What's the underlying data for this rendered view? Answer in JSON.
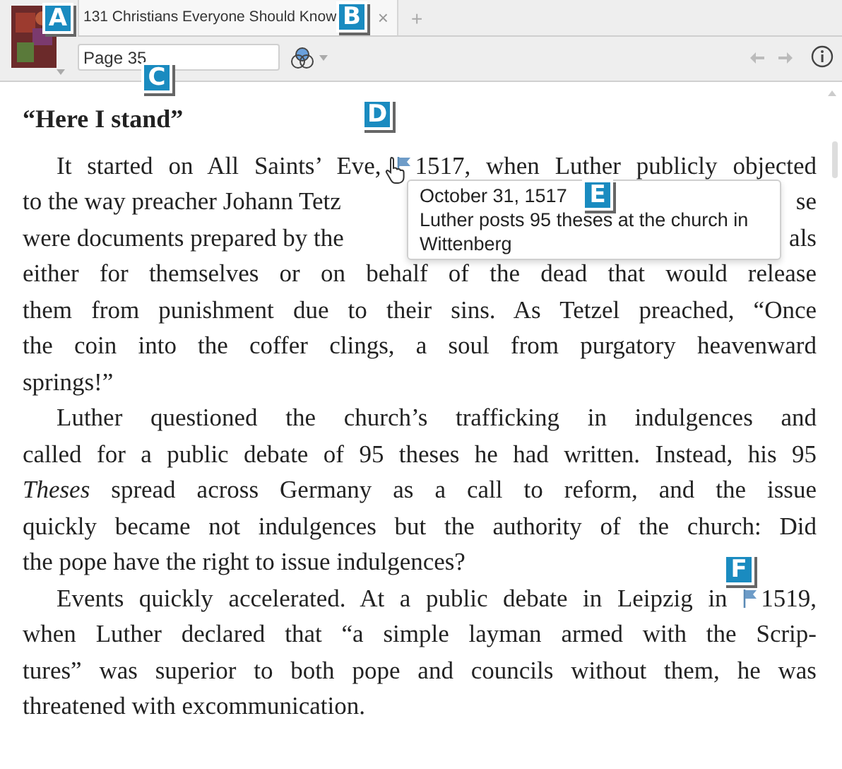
{
  "tab": {
    "title": "131 Christians Everyone Should Know",
    "close": "×",
    "new": "+"
  },
  "toolbar": {
    "page_field": {
      "value": "Page 35"
    }
  },
  "heading": "“Here I stand”",
  "paragraphs": [
    {
      "lines": [
        [
          {
            "kind": "text",
            "text": "It started on All Saints’ Eve,"
          },
          {
            "kind": "flag",
            "text": "1517, when Luther publicly objected"
          }
        ],
        [
          {
            "kind": "text",
            "text": "to the way preacher Johann Tetz"
          },
          {
            "kind": "gap"
          },
          {
            "kind": "text",
            "text": "se"
          }
        ],
        [
          {
            "kind": "text",
            "text": "were documents prepared by the"
          },
          {
            "kind": "gap"
          },
          {
            "kind": "text",
            "text": "als"
          }
        ],
        [
          {
            "kind": "text",
            "text": "either for themselves or on behalf of the dead that would release"
          }
        ],
        [
          {
            "kind": "text",
            "text": "them from punishment due to their sins. As Tetzel preached, “Once"
          }
        ],
        [
          {
            "kind": "text",
            "text": "the coin into the coffer clings, a soul from purgatory heavenward"
          }
        ],
        [
          {
            "kind": "text",
            "text": "springs!”"
          }
        ]
      ]
    },
    {
      "lines": [
        [
          {
            "kind": "text",
            "text": "Luther questioned the church’s trafficking in indulgences and"
          }
        ],
        [
          {
            "kind": "text",
            "text": "called for a public debate of 95 theses he had written. Instead, his 95"
          }
        ],
        [
          {
            "kind": "text",
            "text": "*Theses* spread across Germany as a call to reform, and the issue"
          }
        ],
        [
          {
            "kind": "text",
            "text": "quickly became not indulgences but the authority of the church: Did"
          }
        ],
        [
          {
            "kind": "text",
            "text": "the pope have the right to issue indulgences?"
          }
        ]
      ]
    },
    {
      "lines": [
        [
          {
            "kind": "text",
            "text": "Events quickly accelerated. At a public debate in Leipzig in"
          },
          {
            "kind": "flag",
            "text": "1519,"
          }
        ],
        [
          {
            "kind": "text",
            "text": "when Luther declared that “a simple layman armed with the Scrip-"
          }
        ],
        [
          {
            "kind": "text",
            "text": "tures” was superior to both pope and councils without them, he was"
          }
        ],
        [
          {
            "kind": "text",
            "text": "threatened with excommunication."
          }
        ]
      ]
    }
  ],
  "tooltip": {
    "date": "October 31, 1517",
    "text": "Luther posts 95 theses at the church in Wittenberg"
  },
  "callouts": [
    "A",
    "B",
    "C",
    "D",
    "E",
    "F"
  ]
}
